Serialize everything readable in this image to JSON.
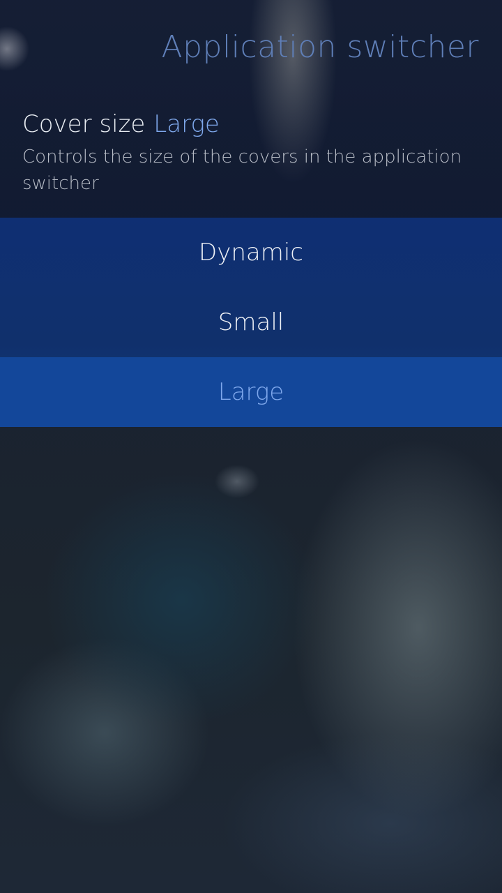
{
  "header": {
    "title": "Application switcher"
  },
  "setting": {
    "label": "Cover size",
    "value": "Large",
    "description": "Controls the size of the covers in the application switcher"
  },
  "menu": {
    "items": [
      {
        "label": "Dynamic",
        "selected": false
      },
      {
        "label": "Small",
        "selected": false
      },
      {
        "label": "Large",
        "selected": true
      }
    ]
  },
  "colors": {
    "accent": "#7fa8ec",
    "title": "#5f7fb8",
    "menu_background": "#10306c",
    "selected_background": "#13479a"
  }
}
